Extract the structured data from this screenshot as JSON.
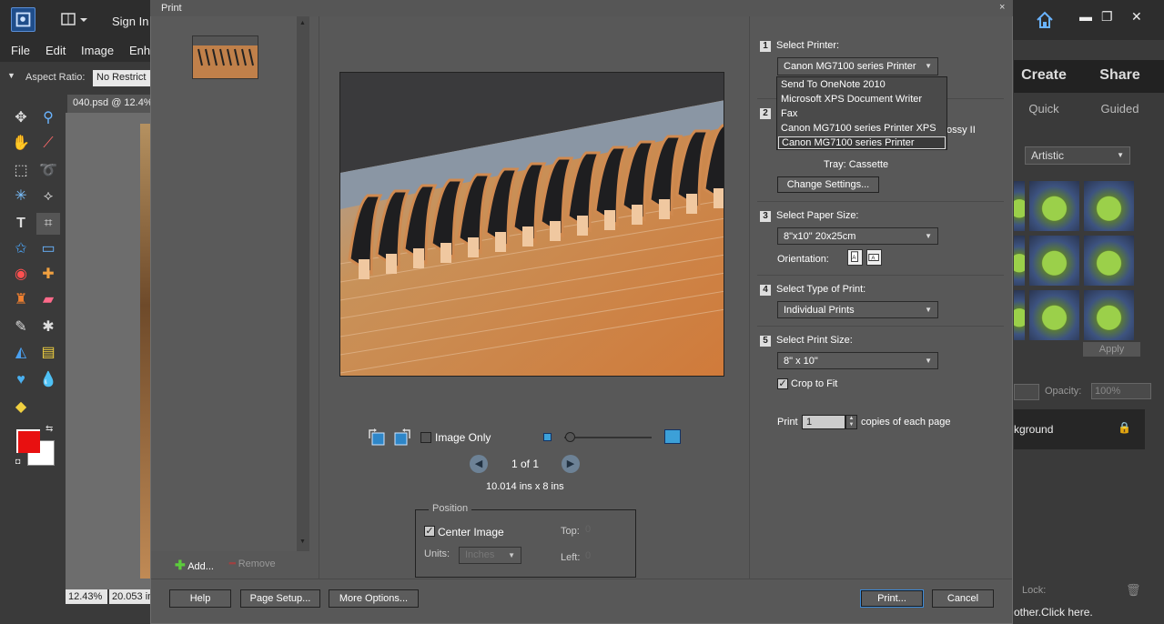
{
  "app": {
    "signin_label": "Sign In",
    "menu": [
      "File",
      "Edit",
      "Image",
      "Enh"
    ],
    "aspect_label": "Aspect Ratio:",
    "aspect_value": "No Restrict",
    "doc_tab": "040.psd @ 12.4%",
    "status_zoom": "12.43%",
    "status_size": "20.053 in",
    "foreground_color": "#e81010",
    "background_color": "#ffffff"
  },
  "right_panel": {
    "tabs": [
      "Create",
      "Share"
    ],
    "subtabs": [
      "Quick",
      "Guided"
    ],
    "effects_select": "Artistic",
    "apply_label": "Apply",
    "opacity_label": "Opacity:",
    "opacity_value": "100%",
    "layer_name": "kground",
    "lock_label": "Lock:",
    "bottom_hint": "other.Click here."
  },
  "dialog": {
    "title": "Print",
    "close_label": "×",
    "add_label": "Add...",
    "remove_label": "Remove",
    "image_only_label": "Image Only",
    "page_indicator": "1 of 1",
    "print_dims": "10.014 ins x 8 ins",
    "position": {
      "legend": "Position",
      "center_image_label": "Center Image",
      "center_image_checked": true,
      "units_label": "Units:",
      "units_value": "Inches",
      "top_label": "Top:",
      "top_value": "0",
      "left_label": "Left:",
      "left_value": "0"
    },
    "steps": [
      {
        "num": "1",
        "label": "Select Printer:"
      },
      {
        "num": "2",
        "label": ""
      },
      {
        "num": "3",
        "label": "Select Paper Size:"
      },
      {
        "num": "4",
        "label": "Select Type of Print:"
      },
      {
        "num": "5",
        "label": "Select Print Size:"
      }
    ],
    "printer_selected": "Canon MG7100 series Printer",
    "printer_options": [
      "Send To OneNote 2010",
      "Microsoft XPS Document Writer",
      "Fax",
      "Canon MG7100 series Printer XPS",
      "Canon MG7100 series Printer"
    ],
    "paper_type_tail": "ossy II",
    "tray_text": "Tray:  Cassette",
    "change_settings_label": "Change Settings...",
    "paper_size": "8\"x10\" 20x25cm",
    "orientation_label": "Orientation:",
    "print_type": "Individual Prints",
    "print_size": "8\" x 10\"",
    "crop_to_fit_label": "Crop to Fit",
    "crop_to_fit_checked": true,
    "copies_prefix": "Print",
    "copies_value": "1",
    "copies_suffix": "copies of each page",
    "footer_buttons": {
      "help": "Help",
      "page_setup": "Page Setup...",
      "more_options": "More Options...",
      "print": "Print...",
      "cancel": "Cancel"
    }
  }
}
